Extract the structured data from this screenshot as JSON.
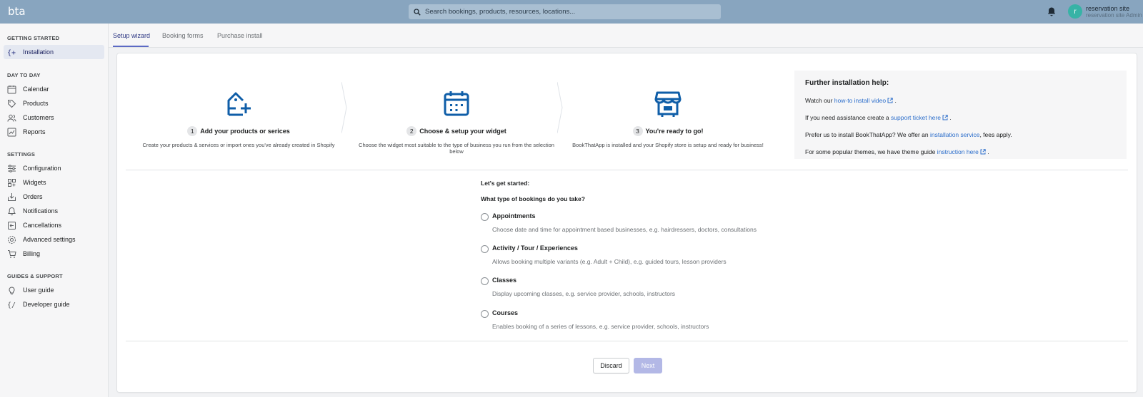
{
  "app": {
    "logo_text": "bta",
    "search_placeholder": "Search bookings, products, resources, locations...",
    "user": {
      "initial": "r",
      "name": "reservation site",
      "role": "reservation site Admin"
    }
  },
  "sidebar": {
    "sections": [
      {
        "title": "GETTING STARTED"
      },
      {
        "title": "DAY TO DAY"
      },
      {
        "title": "SETTINGS"
      },
      {
        "title": "GUIDES & SUPPORT"
      }
    ],
    "items": [
      {
        "label": "Installation",
        "icon": "plus-brackets-icon",
        "active": true
      },
      {
        "label": "Calendar",
        "icon": "calendar-icon"
      },
      {
        "label": "Products",
        "icon": "tag-icon"
      },
      {
        "label": "Customers",
        "icon": "customers-icon"
      },
      {
        "label": "Reports",
        "icon": "reports-icon"
      },
      {
        "label": "Configuration",
        "icon": "sliders-icon"
      },
      {
        "label": "Widgets",
        "icon": "widgets-icon"
      },
      {
        "label": "Orders",
        "icon": "orders-icon"
      },
      {
        "label": "Notifications",
        "icon": "bell-icon"
      },
      {
        "label": "Cancellations",
        "icon": "cancellations-icon"
      },
      {
        "label": "Advanced settings",
        "icon": "gear-icon"
      },
      {
        "label": "Billing",
        "icon": "cart-icon"
      },
      {
        "label": "User guide",
        "icon": "lightbulb-icon"
      },
      {
        "label": "Developer guide",
        "icon": "code-icon"
      }
    ]
  },
  "tabs": [
    {
      "label": "Setup wizard",
      "active": true
    },
    {
      "label": "Booking forms"
    },
    {
      "label": "Purchase install"
    }
  ],
  "steps": [
    {
      "num": "1",
      "title": "Add your products or serices",
      "desc": "Create your products & services or import ones you've already created in Shopify"
    },
    {
      "num": "2",
      "title": "Choose & setup your widget",
      "desc": "Choose the widget most suitable to the type of business you run from the selection below"
    },
    {
      "num": "3",
      "title": "You're ready to go!",
      "desc": "BookThatApp is installed and your Shopify store is setup and ready for business!"
    }
  ],
  "help": {
    "title": "Further installation help:",
    "line1": {
      "pre": "Watch our ",
      "link": "how-to install video",
      "post": " ."
    },
    "line2": {
      "pre": "If you need assistance create a ",
      "link": "support ticket here",
      "post": " ."
    },
    "line3": {
      "pre": "Prefer us to install BookThatApp? We offer an ",
      "link": "installation service",
      "post": ", fees apply."
    },
    "line4": {
      "pre": "For some popular themes, we have theme guide ",
      "link": "instruction here",
      "post": " ."
    }
  },
  "form": {
    "intro": "Let's get started:",
    "question": "What type of bookings do you take?",
    "options": [
      {
        "label": "Appointments",
        "desc": "Choose date and time for appointment based businesses, e.g. hairdressers, doctors, consultations"
      },
      {
        "label": "Activity / Tour / Experiences",
        "desc": "Allows booking multiple variants (e.g. Adult + Child), e.g. guided tours, lesson providers"
      },
      {
        "label": "Classes",
        "desc": "Display upcoming classes, e.g. service provider, schools, instructors"
      },
      {
        "label": "Courses",
        "desc": "Enables booking of a series of lessons, e.g. service provider, schools, instructors"
      }
    ],
    "discard_label": "Discard",
    "next_label": "Next"
  },
  "colors": {
    "topbar": "#88a5bf",
    "accent": "#2c6ecb",
    "step_icon": "#0f5ea8",
    "primary_disabled": "#b3b8e6"
  }
}
